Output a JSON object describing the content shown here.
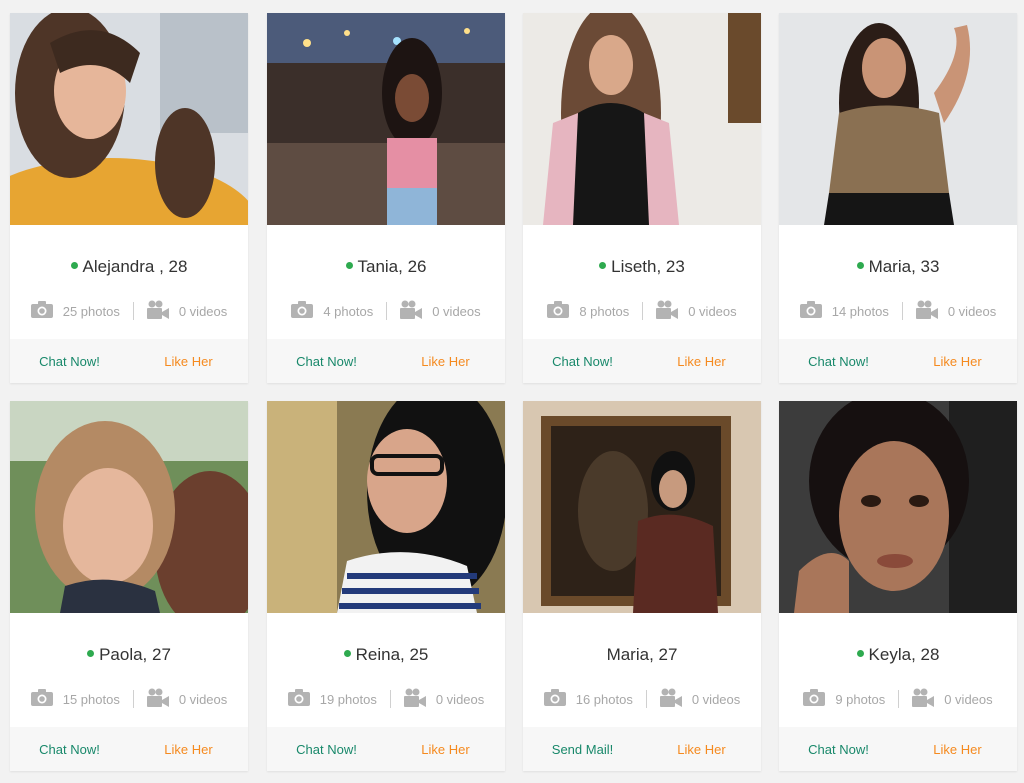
{
  "profiles": [
    {
      "name": "Alejandra , 28",
      "online": true,
      "photos": "25 photos",
      "videos": "0 videos",
      "primary_action": "Chat Now!",
      "like_action": "Like Her"
    },
    {
      "name": "Tania, 26",
      "online": true,
      "photos": "4 photos",
      "videos": "0 videos",
      "primary_action": "Chat Now!",
      "like_action": "Like Her"
    },
    {
      "name": "Liseth, 23",
      "online": true,
      "photos": "8 photos",
      "videos": "0 videos",
      "primary_action": "Chat Now!",
      "like_action": "Like Her"
    },
    {
      "name": "Maria, 33",
      "online": true,
      "photos": "14 photos",
      "videos": "0 videos",
      "primary_action": "Chat Now!",
      "like_action": "Like Her"
    },
    {
      "name": "Paola, 27",
      "online": true,
      "photos": "15 photos",
      "videos": "0 videos",
      "primary_action": "Chat Now!",
      "like_action": "Like Her"
    },
    {
      "name": "Reina, 25",
      "online": true,
      "photos": "19 photos",
      "videos": "0 videos",
      "primary_action": "Chat Now!",
      "like_action": "Like Her"
    },
    {
      "name": "Maria, 27",
      "online": false,
      "photos": "16 photos",
      "videos": "0 videos",
      "primary_action": "Send Mail!",
      "like_action": "Like Her"
    },
    {
      "name": "Keyla, 28",
      "online": true,
      "photos": "9 photos",
      "videos": "0 videos",
      "primary_action": "Chat Now!",
      "like_action": "Like Her"
    }
  ],
  "colors": {
    "online": "#2eaa4f",
    "primary_action": "#18886a",
    "like_action": "#f58a1f",
    "stat_text": "#a7a7a7"
  },
  "icons": {
    "photos": "camera-icon",
    "videos": "video-camera-icon"
  }
}
